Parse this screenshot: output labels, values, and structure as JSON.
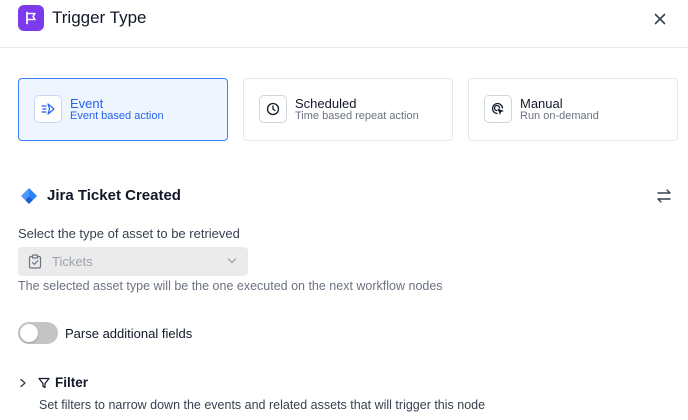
{
  "header": {
    "title": "Trigger Type",
    "icon": "flag-icon",
    "icon_color": "#7c3aed",
    "close_icon": "close-icon"
  },
  "trigger_types": [
    {
      "title": "Event",
      "subtitle": "Event based action",
      "icon": "event-icon",
      "selected": true
    },
    {
      "title": "Scheduled",
      "subtitle": "Time based repeat action",
      "icon": "clock-icon",
      "selected": false
    },
    {
      "title": "Manual",
      "subtitle": "Run on-demand",
      "icon": "cursor-click-icon",
      "selected": false
    }
  ],
  "node": {
    "title": "Jira Ticket Created",
    "icon": "jira-icon",
    "swap_icon": "swap-icon"
  },
  "asset": {
    "label": "Select the type of asset to be retrieved",
    "value": "Tickets",
    "icon": "clipboard-check-icon",
    "help": "The selected asset type will be the one executed on the next workflow nodes"
  },
  "parse_fields": {
    "label": "Parse additional fields",
    "enabled": false
  },
  "filter": {
    "title": "Filter",
    "description": "Set filters to narrow down the events and related assets that will trigger this node",
    "expanded": false
  },
  "colors": {
    "accent": "#2563eb",
    "selected_bg": "#eef5ff",
    "jira_blue": "#2684ff"
  }
}
